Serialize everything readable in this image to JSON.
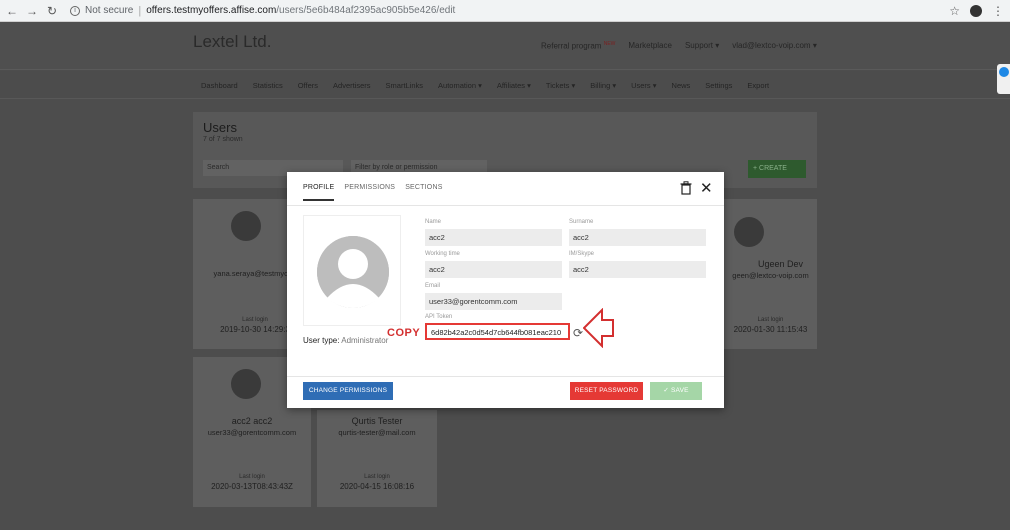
{
  "browser": {
    "security_label": "Not secure",
    "url_host": "offers.testmyoffers.affise.com",
    "url_path": "/users/5e6b484af2395ac905b5e426/edit",
    "icons": [
      "back-icon",
      "forward-icon",
      "reload-icon",
      "info-icon",
      "star-icon",
      "profile-icon",
      "menu-icon"
    ]
  },
  "header": {
    "brand": "Lextel Ltd.",
    "referral": "Referral program",
    "referral_badge": "NEW",
    "marketplace": "Marketplace",
    "support": "Support ▾",
    "account": "vlad@lextco-voip.com ▾"
  },
  "nav": {
    "items": [
      "Dashboard",
      "Statistics",
      "Offers",
      "Advertisers",
      "SmartLinks",
      "Automation ▾",
      "Affiliates ▾",
      "Tickets ▾",
      "Billing ▾",
      "Users ▾",
      "News",
      "Settings",
      "Export"
    ]
  },
  "users_panel": {
    "title": "Users",
    "subtitle": "7 of 7 shown",
    "search_placeholder": "Search",
    "filter_placeholder": "Filter by role or permission",
    "create_label": "+   CREATE"
  },
  "cards": [
    {
      "name": "",
      "email": "yana.seraya@testmyoffe",
      "last_login_label": "Last login",
      "last_login": "2019-10-30 14:29:3"
    },
    {
      "name": "Ugeen Dev",
      "email": "geen@lextco-voip.com",
      "last_login_label": "Last login",
      "last_login": "2020-01-30 11:15:43"
    },
    {
      "name": "acc2 acc2",
      "email": "user33@gorentcomm.com",
      "last_login_label": "Last login",
      "last_login": "2020-03-13T08:43:43Z"
    },
    {
      "name": "Qurtis Tester",
      "email": "qurtis-tester@mail.com",
      "last_login_label": "Last login",
      "last_login": "2020-04-15 16:08:16"
    }
  ],
  "modal": {
    "tabs": [
      "PROFILE",
      "PERMISSIONS",
      "SECTIONS"
    ],
    "active_tab": "PROFILE",
    "fields": {
      "name_label": "Name",
      "name": "acc2",
      "surname_label": "Surname",
      "surname": "acc2",
      "working_time_label": "Working time",
      "working_time": "acc2",
      "im_label": "IM/Skype",
      "im": "acc2",
      "email_label": "Email",
      "email": "user33@gorentcomm.com",
      "token_label": "API Token",
      "token": "6d82b42a2c0d54d7cb644fb081eac210"
    },
    "user_type_label": "User type:",
    "user_type": "Administrator",
    "buttons": {
      "change_permissions": "CHANGE PERMISSIONS",
      "reset_password": "RESET PASSWORD",
      "save": "✓   SAVE"
    },
    "colors": {
      "primary": "#2f6db5",
      "danger": "#e53935",
      "save_disabled": "#a5d6a7"
    }
  },
  "annotation": {
    "label": "COPY",
    "color": "#d32f2f"
  }
}
